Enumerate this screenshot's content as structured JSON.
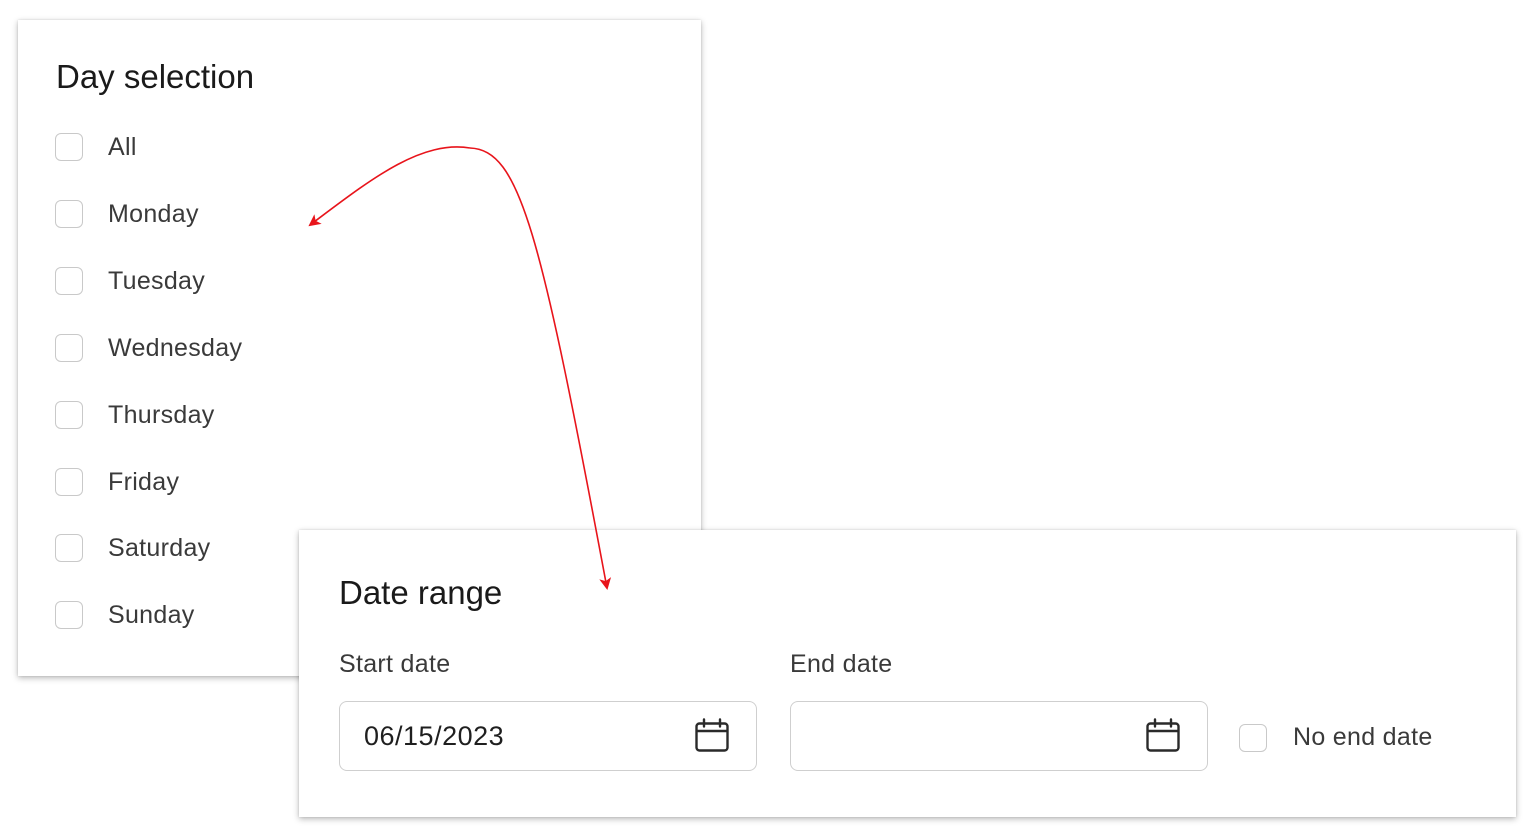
{
  "day_selection": {
    "title": "Day selection",
    "options": [
      {
        "label": "All",
        "checked": false
      },
      {
        "label": "Monday",
        "checked": false
      },
      {
        "label": "Tuesday",
        "checked": false
      },
      {
        "label": "Wednesday",
        "checked": false
      },
      {
        "label": "Thursday",
        "checked": false
      },
      {
        "label": "Friday",
        "checked": false
      },
      {
        "label": "Saturday",
        "checked": false
      },
      {
        "label": "Sunday",
        "checked": false
      }
    ]
  },
  "date_range": {
    "title": "Date range",
    "start_label": "Start date",
    "start_value": "06/15/2023",
    "end_label": "End date",
    "end_value": "",
    "no_end_label": "No end date",
    "no_end_checked": false
  },
  "icons": {
    "calendar": "calendar-icon"
  },
  "colors": {
    "annotation_arrow": "#e8141b",
    "checkbox_border": "#c9c9c9"
  }
}
